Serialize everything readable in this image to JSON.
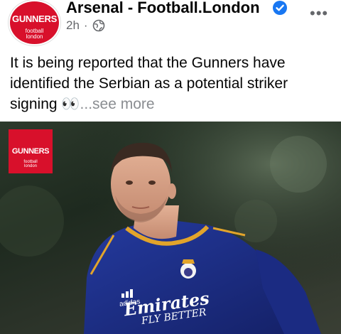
{
  "header": {
    "page_name": "Arsenal - Football.London",
    "time": "2h",
    "separator": "·",
    "avatar_logo": "GUNNERS",
    "avatar_sub": "football\nlondon",
    "more_icon": "more-options-icon",
    "verified_icon": "verified-badge-icon",
    "audience_icon": "globe-icon"
  },
  "post": {
    "text": "It is being reported that the Gunners have identified the Serbian as a potential striker signing 👀",
    "see_more": "...see more"
  },
  "photo": {
    "badge_text": "GUNNERS",
    "badge_sub": "football\nlondon",
    "shirt_sponsor_line1": "Emirates",
    "shirt_sponsor_line2": "FLY BETTER",
    "kit_brand": "adidas"
  },
  "colors": {
    "brand_red": "#d8102b",
    "verified_blue": "#1877f2",
    "shirt_blue": "#1c2f8c",
    "trim_gold": "#e2a42b"
  }
}
